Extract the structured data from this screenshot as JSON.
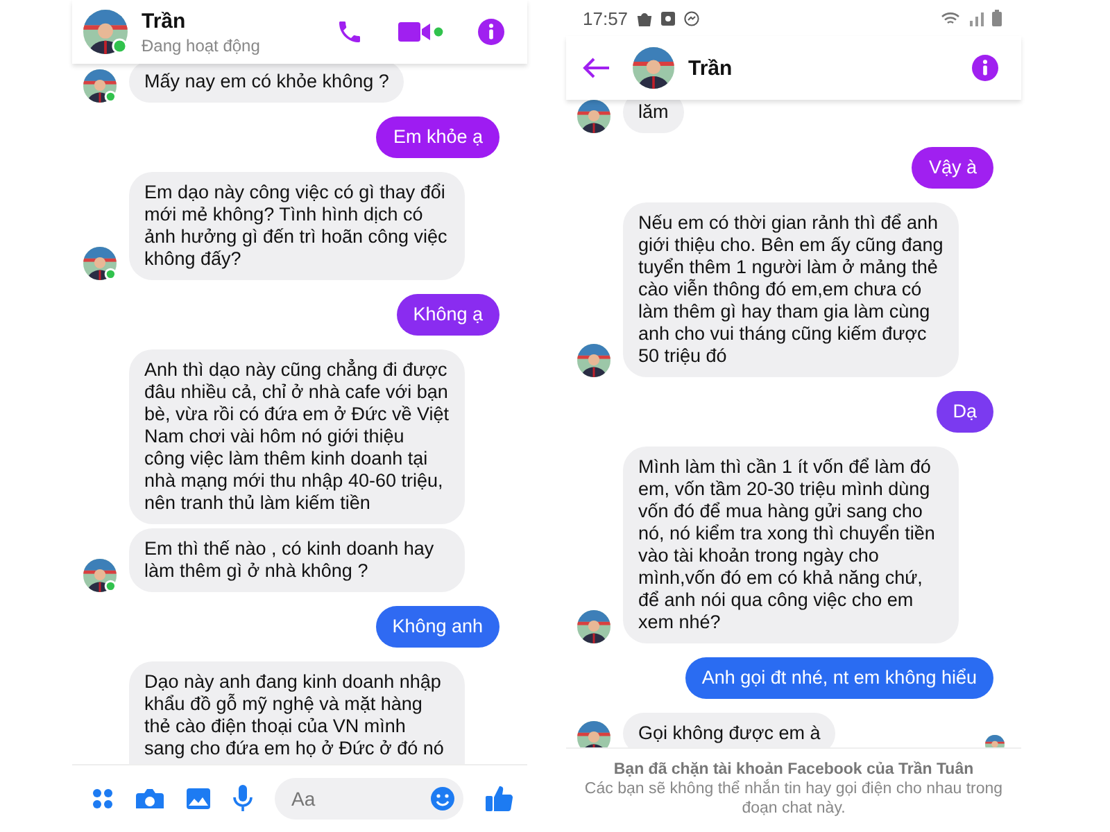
{
  "left_screen": {
    "online": true,
    "header": {
      "name": "Trần",
      "subtitle": "Đang hoạt động",
      "back": false,
      "actions": [
        {
          "kind": "call"
        },
        {
          "kind": "video"
        },
        {
          "kind": "info"
        }
      ]
    },
    "messages": [
      {
        "kind": "in",
        "avatar": true,
        "text": "Mấy nay em có khỏe không ?"
      },
      {
        "kind": "out",
        "color": "#9e1cf2",
        "text": "Em khỏe ạ"
      },
      {
        "kind": "in",
        "avatar": true,
        "text": "Em dạo này công việc có gì thay đổi mới mẻ không? Tình hình dịch có ảnh hưởng gì đến trì hoãn công việc không đấy?"
      },
      {
        "kind": "out",
        "color": "#8a2cf0",
        "text": "Không ạ"
      },
      {
        "kind": "in",
        "avatar": false,
        "text": "Anh thì dạo này cũng chẳng đi được đâu nhiều cả, chỉ ở nhà cafe với bạn bè, vừa rồi có đứa em ở Đức về Việt Nam chơi vài hôm nó giới thiệu công việc làm thêm kinh doanh tại nhà mạng mới thu nhập 40-60 triệu, nên tranh thủ làm kiếm tiền"
      },
      {
        "kind": "in",
        "avatar": true,
        "text": "Em thì thế nào , có kinh doanh hay làm thêm gì ở nhà không ?"
      },
      {
        "kind": "out",
        "color": "#2f6af2",
        "text": "Không anh"
      },
      {
        "kind": "in",
        "avatar": false,
        "cut_bottom": true,
        "text": "Dạo này anh đang kinh doanh nhập khẩu đồ gỗ mỹ nghệ và mặt hàng thẻ cào điện thoại của VN mình sang cho đứa em họ ở Đức ở đó nó"
      }
    ],
    "composer": {
      "placeholder": "Aa"
    }
  },
  "right_screen": {
    "online": false,
    "status_bar": {
      "time": "17:57"
    },
    "header": {
      "name": "Trần",
      "back": true,
      "actions": [
        {
          "kind": "info"
        }
      ]
    },
    "messages": [
      {
        "kind": "in",
        "avatar": true,
        "cut_top": true,
        "text": "lăm"
      },
      {
        "kind": "out",
        "color": "#a020f0",
        "text": "Vậy à"
      },
      {
        "kind": "in",
        "avatar": true,
        "text": "Nếu em có thời gian rảnh thì để anh giới thiệu cho. Bên em ấy cũng đang tuyển thêm 1 người làm ở mảng thẻ cào viễn thông đó em,em chưa có làm thêm gì hay tham gia làm cùng anh cho vui tháng cũng kiếm được 50 triệu đó"
      },
      {
        "kind": "out",
        "color": "#7b3af0",
        "text": "Dạ"
      },
      {
        "kind": "in",
        "avatar": true,
        "text": "Mình làm thì cần 1 ít vốn để làm đó em, vốn tầm 20-30 triệu mình dùng vốn đó để mua hàng gửi sang cho nó, nó kiểm tra xong thì chuyển tiền vào tài khoản trong ngày cho mình,vốn đó em có khả năng chứ, để anh nói qua công việc cho em xem nhé?"
      },
      {
        "kind": "out",
        "color": "#2a6cf2",
        "text": "Anh gọi đt nhé, nt em không hiểu"
      },
      {
        "kind": "in",
        "avatar": true,
        "seen": true,
        "text": "Gọi không được em à"
      }
    ],
    "notice": {
      "title": "Bạn đã chặn tài khoản Facebook của Trần Tuân",
      "body": "Các bạn sẽ không thể nhắn tin hay gọi điện cho nhau trong đoạn chat này."
    }
  }
}
